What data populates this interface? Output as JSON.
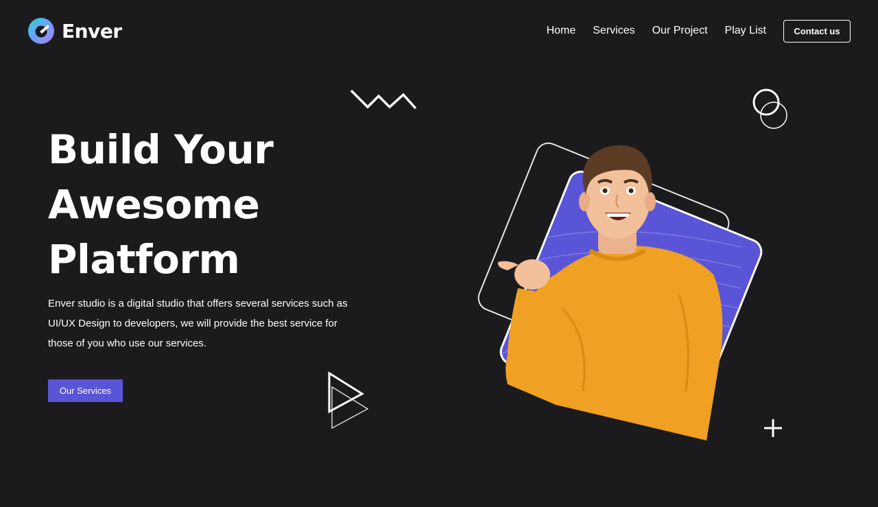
{
  "brand": {
    "name": "Enver",
    "logo_icon": "enver-logo-icon"
  },
  "nav": {
    "items": [
      {
        "label": "Home"
      },
      {
        "label": "Services"
      },
      {
        "label": "Our Project"
      },
      {
        "label": "Play List"
      }
    ],
    "contact_label": "Contact us"
  },
  "hero": {
    "title_lines": [
      "Build Your",
      "Awesome",
      "Platform"
    ],
    "description": "Enver studio is a digital studio that offers several services such as UI/UX Design to developers, we will provide the best service for those of you who use our services.",
    "cta_label": "Our Services"
  },
  "colors": {
    "background": "#1b1b1d",
    "accent": "#5a55d6",
    "sweater": "#f0a023",
    "text": "#ffffff"
  }
}
